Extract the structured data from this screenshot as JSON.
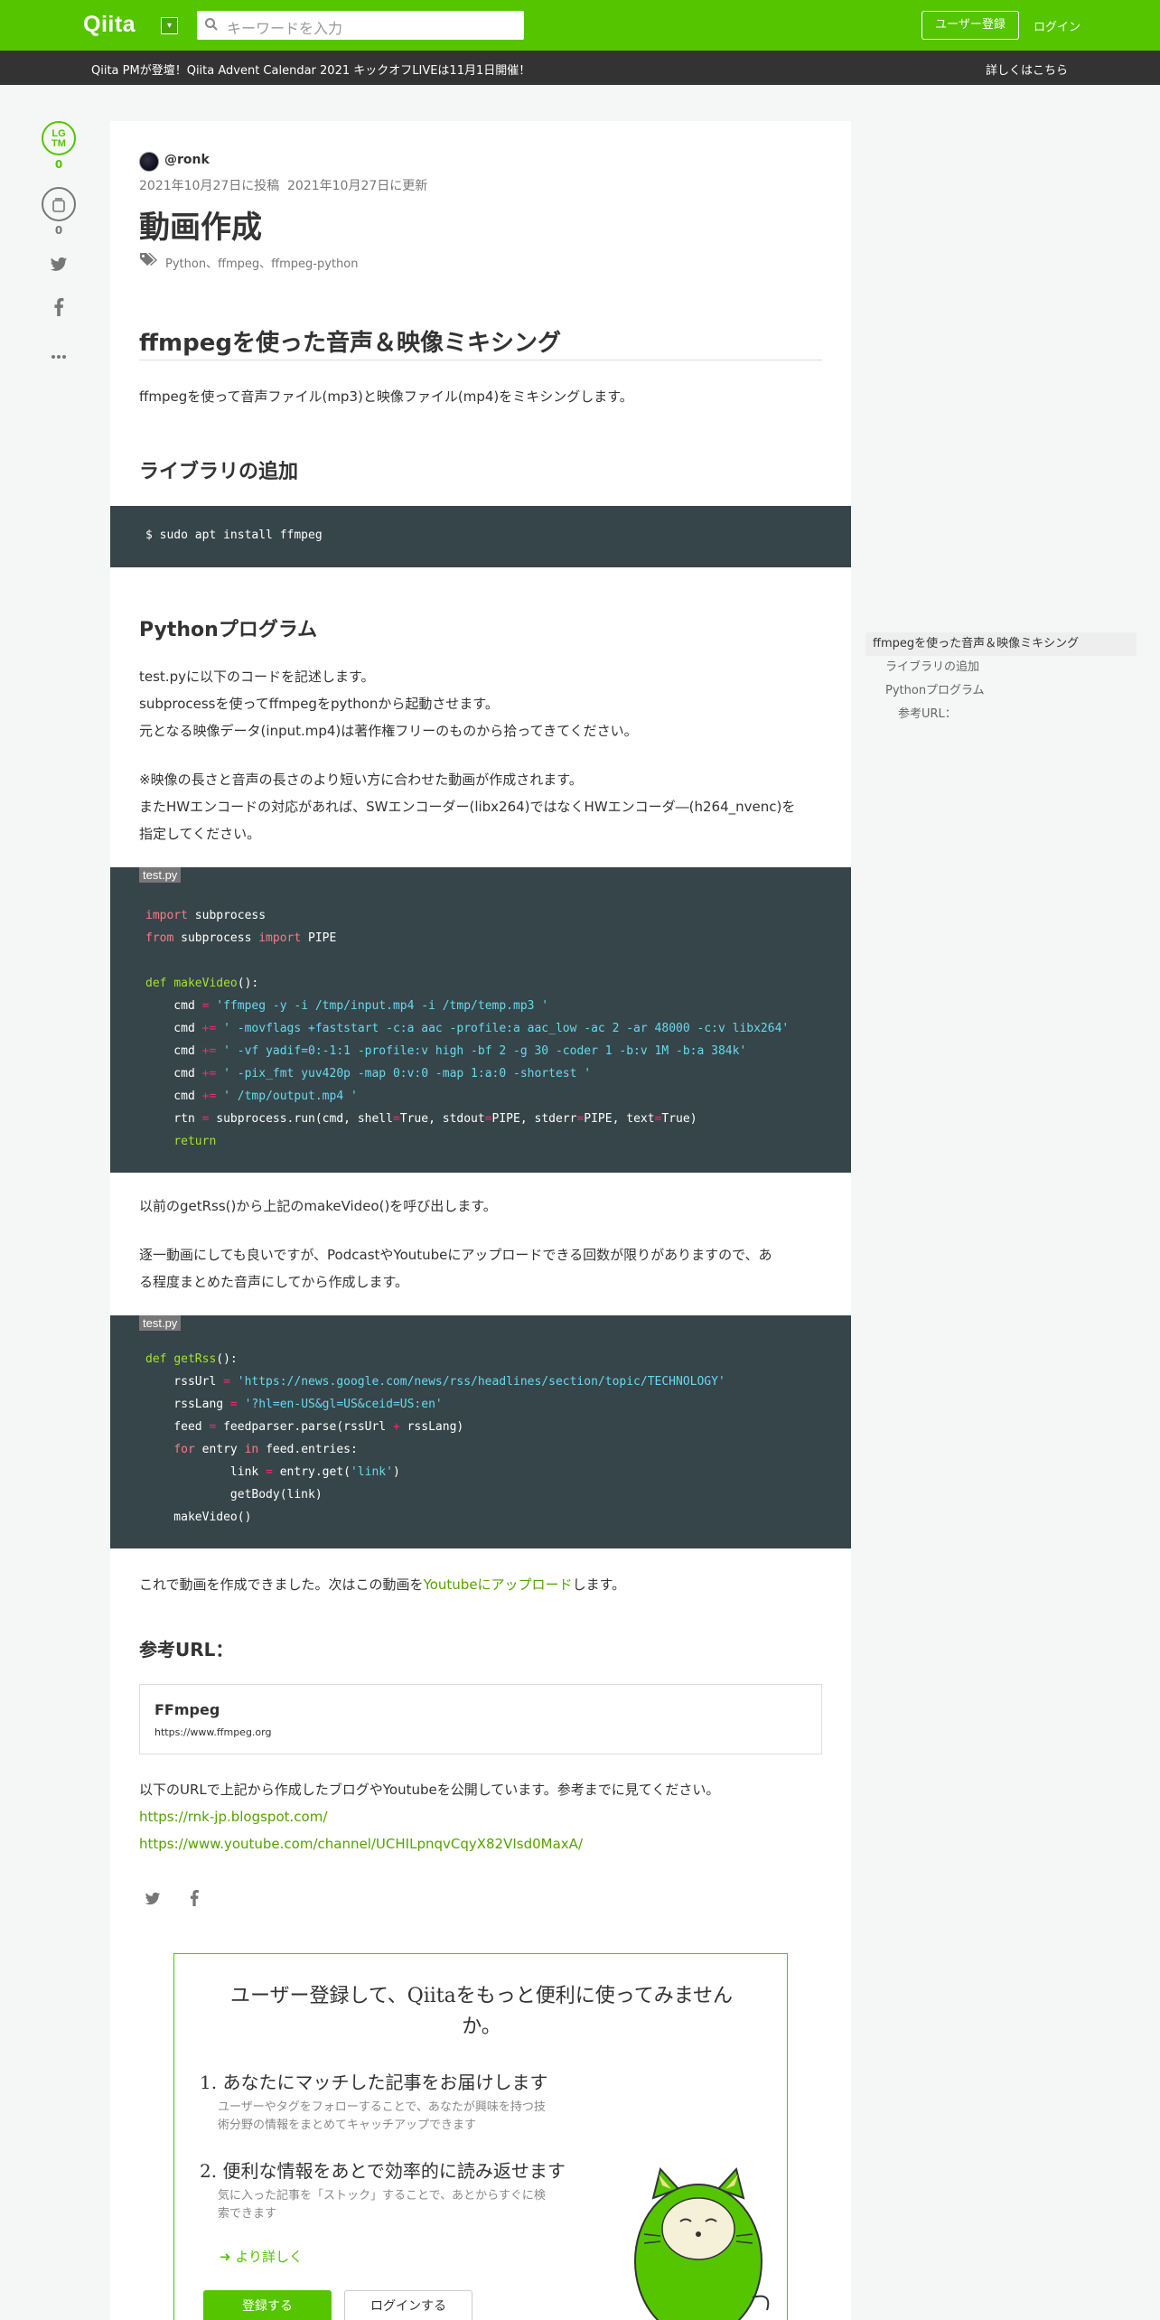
{
  "header": {
    "logo": "Qiita",
    "logo_dropdown": "▾",
    "search_placeholder": "キーワードを入力",
    "signup": "ユーザー登録",
    "login": "ログイン"
  },
  "announcement": {
    "text": "Qiita PMが登壇！Qiita Advent Calendar 2021 キックオフLIVEは11月1日開催！",
    "link": "詳しくはこちら"
  },
  "side_actions": {
    "lgtm_label_1": "LG",
    "lgtm_label_2": "TM",
    "lgtm_count": "0",
    "stock_count": "0"
  },
  "article": {
    "author": "@ronk",
    "posted": "2021年10月27日に投稿",
    "updated": "2021年10月27日に更新",
    "title": "動画作成",
    "tags": "Python、ffmpeg、ffmpeg-python",
    "h1": "ffmpegを使った音声＆映像ミキシング",
    "intro": "ffmpegを使って音声ファイル(mp3)と映像ファイル(mp4)をミキシングします。",
    "h2_lib": "ライブラリの追加",
    "code_install": "$ sudo apt install ffmpeg",
    "h2_python": "Pythonプログラム",
    "p1_l1": "test.pyに以下のコードを記述します。",
    "p1_l2": "subprocessを使ってffmpegをpythonから起動させます。",
    "p1_l3": "元となる映像データ(input.mp4)は著作権フリーのものから拾ってきてください。",
    "p2_l1": "※映像の長さと音声の長さのより短い方に合わせた動画が作成されます。",
    "p2_l2": "またHWエンコードの対応があれば、SWエンコーダー(libx264)ではなくHWエンコーダ―(h264_nvenc)を",
    "p2_l3": "指定してください。",
    "code1_filename": "test.py",
    "p3": "以前のgetRss()から上記のmakeVideo()を呼び出します。",
    "p4_l1": "逐一動画にしても良いですが、PodcastやYoutubeにアップロードできる回数が限りがありますので、あ",
    "p4_l2": "る程度まとめた音声にしてから作成します。",
    "code2_filename": "test.py",
    "p5_pre": "これで動画を作成できました。次はこの動画を",
    "p5_link": "Youtubeにアップロード",
    "p5_post": "します。",
    "h2_ref": "参考URL：",
    "embed_title": "FFmpeg",
    "embed_url": "https://www.ffmpeg.org",
    "p6": "以下のURLで上記から作成したブログやYoutubeを公開しています。参考までに見てください。",
    "link1": "https://rnk-jp.blogspot.com/",
    "link2": "https://www.youtube.com/channel/UCHILpnqvCqyX82VIsd0MaxA/"
  },
  "toc": {
    "items": [
      "ffmpegを使った音声＆映像ミキシング",
      "ライブラリの追加",
      "Pythonプログラム",
      "参考URL："
    ]
  },
  "register": {
    "title_l1": "ユーザー登録して、Qiitaをもっと便利に使ってみません",
    "title_l2": "か。",
    "item1_title": "1. あなたにマッチした記事をお届けします",
    "item1_l1": "ユーザーやタグをフォローすることで、あなたが興味を持つ技",
    "item1_l2": "術分野の情報をまとめてキャッチアップできます",
    "item2_title": "2. 便利な情報をあとで効率的に読み返せます",
    "item2_l1": "気に入った記事を「ストック」することで、あとからすぐに検",
    "item2_l2": "索できます",
    "more": "より詳しく",
    "btn_signup": "登録する",
    "btn_login": "ログインする"
  },
  "colors": {
    "brand": "#55c500",
    "code_bg": "#364549"
  }
}
